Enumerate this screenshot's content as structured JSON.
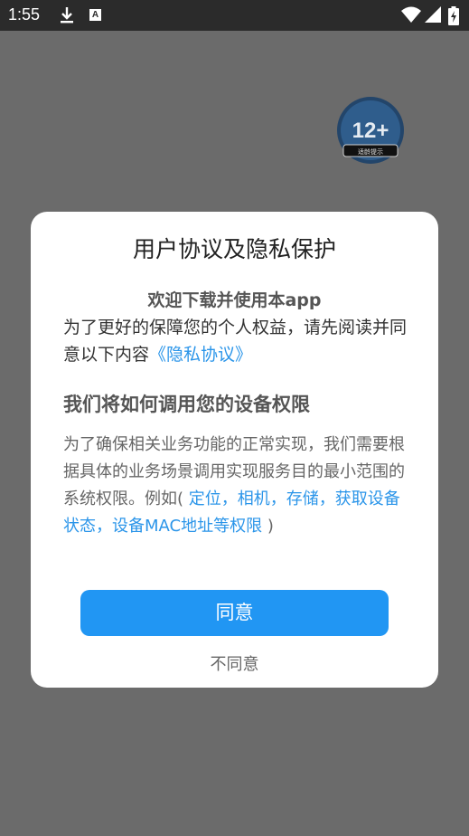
{
  "status_bar": {
    "time": "1:55",
    "a_icon_text": "A"
  },
  "badge": {
    "age_text": "12+",
    "caption": "适龄提示"
  },
  "dialog": {
    "title": "用户协议及隐私保护",
    "welcome": "欢迎下载并使用本app",
    "intro_text": "为了更好的保障您的个人权益，请先阅读并同意以下内容",
    "privacy_link": "《隐私协议》",
    "subtitle": "我们将如何调用您的设备权限",
    "desc_text": "为了确保相关业务功能的正常实现，我们需要根据具体的业务场景调用实现服务目的最小范围的系统权限。例如(",
    "permissions_link": " 定位，相机，存储，获取设备状态，设备MAC地址等权限",
    "desc_end": " )",
    "agree_label": "同意",
    "disagree_label": "不同意"
  },
  "colors": {
    "accent": "#2196f3",
    "link": "#2b95e9",
    "overlay": "#6b6b6b",
    "status_bar": "#2b2b2b"
  }
}
